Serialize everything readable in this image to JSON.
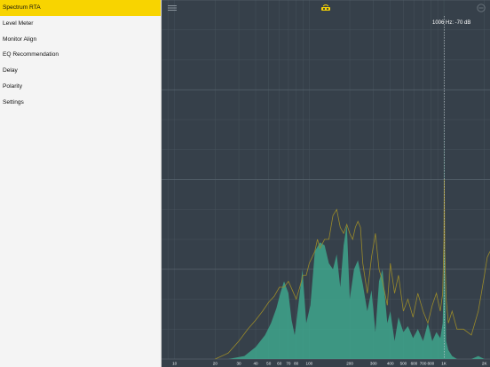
{
  "sidebar": {
    "items": [
      {
        "label": "Spectrum RTA",
        "active": true
      },
      {
        "label": "Level Meter",
        "active": false
      },
      {
        "label": "Monitor Align",
        "active": false
      },
      {
        "label": "EQ Recommendation",
        "active": false
      },
      {
        "label": "Delay",
        "active": false
      },
      {
        "label": "Polarity",
        "active": false
      },
      {
        "label": "Settings",
        "active": false
      }
    ]
  },
  "toolbar": {
    "menu_icon": "hamburger-menu-icon",
    "logo_icon": "speaker-logo-icon",
    "right_icon": "circle-status-icon"
  },
  "readout": {
    "text": "1006 Hz: -70 dB"
  },
  "colors": {
    "accent": "#f8d400",
    "plot_bg": "#36404a",
    "grid": "#46525c",
    "fill": "#3fae92",
    "trace": "#9a8a2a"
  },
  "chart_data": {
    "type": "area",
    "x_scale": "log",
    "xlim": [
      8,
      2200
    ],
    "ylim": [
      -120,
      0
    ],
    "cursor_hz": 1006,
    "x_tick_labels": [
      {
        "hz": 10,
        "label": "10"
      },
      {
        "hz": 20,
        "label": "20"
      },
      {
        "hz": 30,
        "label": "30"
      },
      {
        "hz": 40,
        "label": "40"
      },
      {
        "hz": 50,
        "label": "50"
      },
      {
        "hz": 60,
        "label": "60"
      },
      {
        "hz": 70,
        "label": "70"
      },
      {
        "hz": 80,
        "label": "80"
      },
      {
        "hz": 100,
        "label": "100"
      },
      {
        "hz": 200,
        "label": "200"
      },
      {
        "hz": 300,
        "label": "300"
      },
      {
        "hz": 400,
        "label": "400"
      },
      {
        "hz": 500,
        "label": "500"
      },
      {
        "hz": 600,
        "label": "600"
      },
      {
        "hz": 700,
        "label": "700"
      },
      {
        "hz": 800,
        "label": "800"
      },
      {
        "hz": 1000,
        "label": "1K"
      },
      {
        "hz": 2000,
        "label": "2K"
      }
    ],
    "series": [
      {
        "kind": "fill",
        "x": [
          25,
          33,
          40,
          47,
          52,
          57,
          61,
          65,
          70,
          74,
          78,
          84,
          89,
          95,
          102,
          110,
          120,
          130,
          140,
          150,
          160,
          170,
          180,
          190,
          200,
          215,
          230,
          250,
          270,
          290,
          310,
          330,
          350,
          380,
          400,
          430,
          460,
          500,
          540,
          590,
          640,
          700,
          760,
          820,
          880,
          940,
          980,
          1000,
          1006,
          1015,
          1040,
          1080,
          1150,
          1250,
          1400,
          1600,
          1800,
          2000,
          2200
        ],
        "y": [
          -120,
          -119,
          -116,
          -112,
          -108,
          -103,
          -98,
          -94,
          -98,
          -107,
          -112,
          -100,
          -90,
          -108,
          -102,
          -84,
          -81,
          -82,
          -88,
          -90,
          -85,
          -96,
          -82,
          -75,
          -100,
          -90,
          -87,
          -95,
          -104,
          -97,
          -111,
          -94,
          -90,
          -108,
          -104,
          -114,
          -106,
          -111,
          -109,
          -113,
          -110,
          -114,
          -108,
          -114,
          -111,
          -113,
          -108,
          -90,
          -38,
          -90,
          -114,
          -117,
          -119,
          -120,
          -120,
          -120,
          -119,
          -120,
          -120
        ]
      },
      {
        "kind": "trace",
        "x": [
          20,
          25,
          30,
          35,
          40,
          45,
          50,
          55,
          60,
          65,
          70,
          75,
          80,
          85,
          90,
          95,
          100,
          105,
          110,
          115,
          120,
          130,
          140,
          150,
          160,
          170,
          180,
          190,
          200,
          210,
          220,
          230,
          240,
          250,
          270,
          290,
          310,
          330,
          350,
          380,
          400,
          430,
          460,
          500,
          540,
          590,
          640,
          700,
          760,
          820,
          880,
          940,
          980,
          1000,
          1006,
          1015,
          1040,
          1080,
          1150,
          1250,
          1400,
          1600,
          1800,
          1900,
          2000,
          2100,
          2200
        ],
        "y": [
          -120,
          -118,
          -114,
          -110,
          -107,
          -104,
          -101,
          -99,
          -96,
          -96,
          -94,
          -97,
          -100,
          -96,
          -92,
          -92,
          -88,
          -86,
          -84,
          -80,
          -83,
          -80,
          -80,
          -72,
          -70,
          -76,
          -78,
          -75,
          -78,
          -80,
          -76,
          -74,
          -76,
          -88,
          -98,
          -86,
          -78,
          -90,
          -94,
          -102,
          -88,
          -98,
          -92,
          -104,
          -100,
          -106,
          -98,
          -104,
          -108,
          -102,
          -98,
          -104,
          -98,
          -80,
          -60,
          -84,
          -100,
          -108,
          -104,
          -110,
          -110,
          -112,
          -104,
          -98,
          -92,
          -86,
          -84
        ]
      }
    ]
  }
}
